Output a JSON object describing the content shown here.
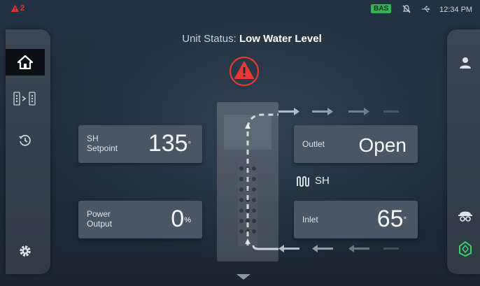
{
  "status_bar": {
    "alarm_count": "2",
    "bas_label": "BAS",
    "time": "12:34 PM"
  },
  "unit_status": {
    "prefix": "Unit Status:",
    "value": "Low Water Level"
  },
  "tiles": {
    "sh_setpoint": {
      "label_line1": "SH",
      "label_line2": "Setpoint",
      "value": "135",
      "unit": "°"
    },
    "power_output": {
      "label_line1": "Power",
      "label_line2": "Output",
      "value": "0",
      "unit": "%"
    },
    "outlet": {
      "label": "Outlet",
      "value": "Open"
    },
    "inlet": {
      "label": "Inlet",
      "value": "65",
      "unit": "°"
    }
  },
  "sh_label": "SH",
  "colors": {
    "alarm": "#e53935",
    "bas": "#2fb457",
    "accent_green": "#3ecf6a"
  },
  "left_nav": [
    {
      "name": "home-icon",
      "active": true
    },
    {
      "name": "flow-compare-icon"
    },
    {
      "name": "history-icon"
    },
    {
      "name": "settings-gear-icon"
    }
  ],
  "right_nav": [
    {
      "name": "user-icon"
    },
    {
      "name": "service-technician-icon"
    },
    {
      "name": "brand-leaf-icon"
    }
  ]
}
